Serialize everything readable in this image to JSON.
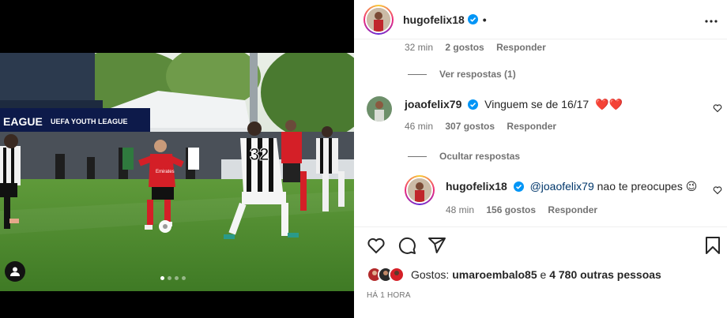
{
  "post": {
    "author": "hugofelix18",
    "separator": "•",
    "more_icon": "more-horizontal-icon"
  },
  "media": {
    "banner_text": "EAGUE",
    "banner_text2": "UEFA YOUTH LEAGUE",
    "shirt_number": "32",
    "sponsor": "Emirates",
    "carousel_count": 4,
    "carousel_active": 1
  },
  "comments": {
    "prev": {
      "time": "32 min",
      "likes": "2 gostos",
      "reply": "Responder",
      "view_replies": "Ver respostas (1)"
    },
    "main": {
      "user": "joaofelix79",
      "text": "Vinguem se de 16/17",
      "emoji": "❤️❤️",
      "time": "46 min",
      "likes": "307 gostos",
      "reply": "Responder",
      "hide_replies": "Ocultar respostas"
    },
    "reply": {
      "user": "hugofelix18",
      "mention": "@joaofelix79",
      "text": " nao te preocupes ",
      "emoji": "😉",
      "time": "48 min",
      "likes": "156 gostos",
      "reply": "Responder"
    }
  },
  "likes": {
    "prefix": "Gostos:",
    "user": "umaroembalo85",
    "conj": " e ",
    "others": "4 780 outras pessoas"
  },
  "timestamp": "HÁ 1 HORA",
  "colors": {
    "verified": "#0095f6",
    "heart": "#ed4956",
    "muted": "#737373"
  }
}
